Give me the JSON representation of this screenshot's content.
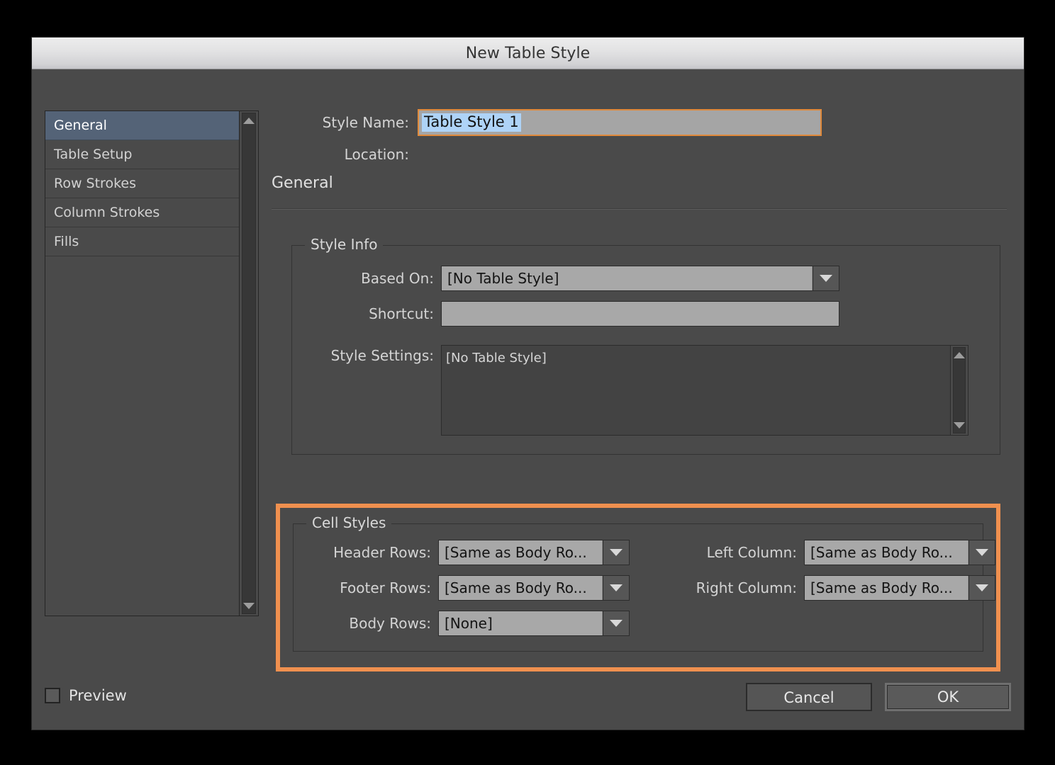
{
  "window": {
    "title": "New Table Style"
  },
  "sidebar": {
    "items": [
      {
        "label": "General"
      },
      {
        "label": "Table Setup"
      },
      {
        "label": "Row Strokes"
      },
      {
        "label": "Column Strokes"
      },
      {
        "label": "Fills"
      }
    ],
    "selected_index": 0,
    "scroll_up_icon": "triangle-up-icon",
    "scroll_down_icon": "triangle-down-icon"
  },
  "form": {
    "style_name_label": "Style Name:",
    "style_name_value": "Table Style 1",
    "location_label": "Location:",
    "location_value": "",
    "section_title": "General"
  },
  "style_info": {
    "legend": "Style Info",
    "based_on_label": "Based On:",
    "based_on_value": "[No Table Style]",
    "shortcut_label": "Shortcut:",
    "shortcut_value": "",
    "style_settings_label": "Style Settings:",
    "style_settings_value": "[No Table Style]"
  },
  "cell_styles": {
    "legend": "Cell Styles",
    "highlight_color": "#f0904f",
    "header_rows_label": "Header Rows:",
    "header_rows_value": "[Same as Body Ro...",
    "footer_rows_label": "Footer Rows:",
    "footer_rows_value": "[Same as Body Ro...",
    "body_rows_label": "Body Rows:",
    "body_rows_value": "[None]",
    "left_column_label": "Left Column:",
    "left_column_value": "[Same as Body Ro...",
    "right_column_label": "Right Column:",
    "right_column_value": "[Same as Body Ro..."
  },
  "footer": {
    "preview_label": "Preview",
    "preview_checked": false,
    "cancel_label": "Cancel",
    "ok_label": "OK"
  }
}
